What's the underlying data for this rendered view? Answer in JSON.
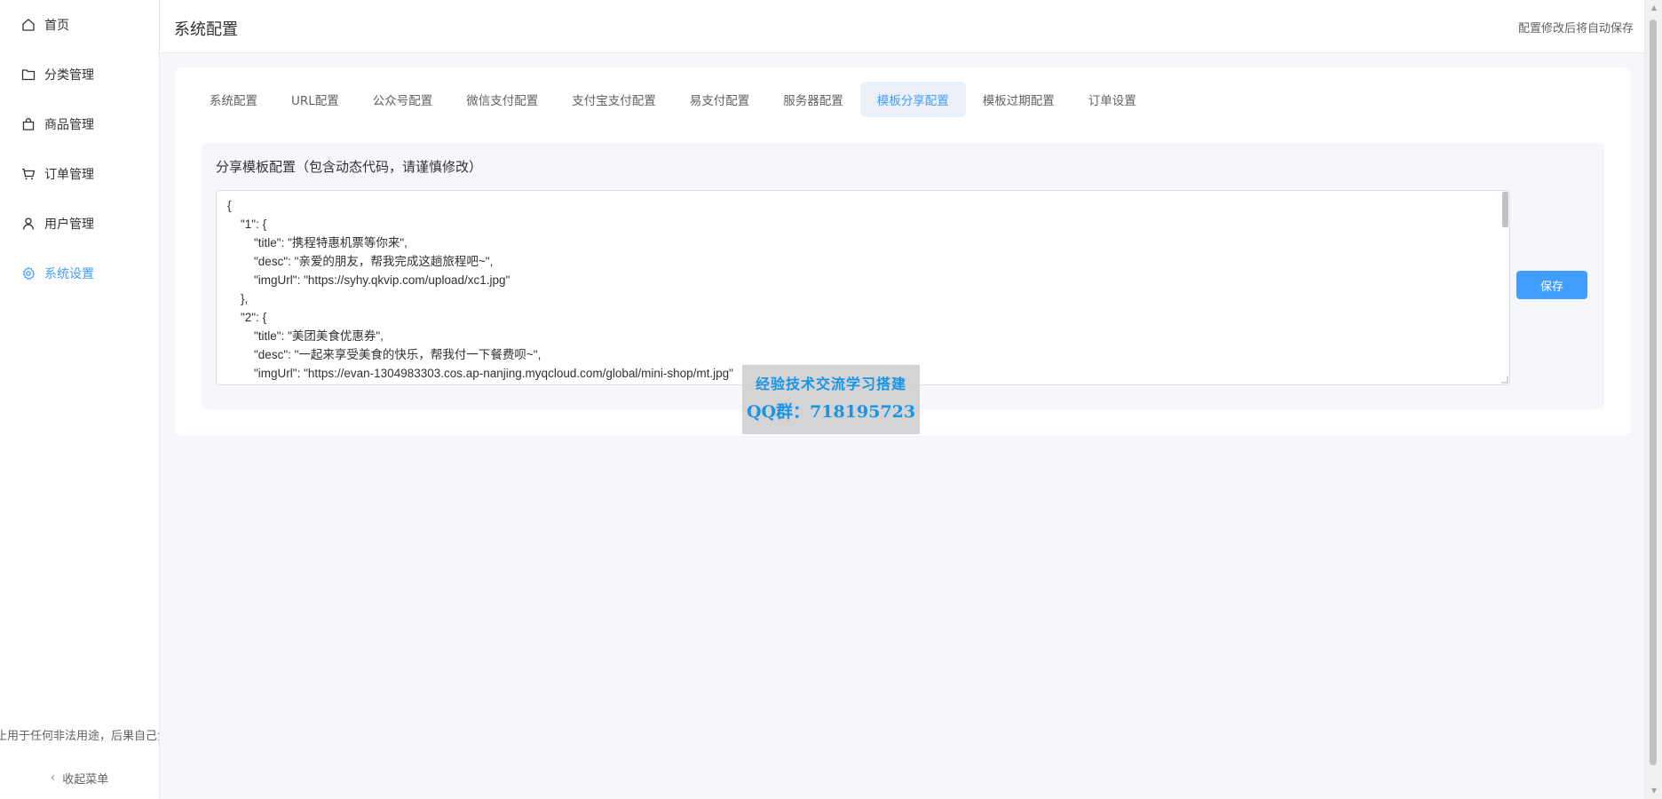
{
  "sidebar": {
    "items": [
      {
        "label": "首页",
        "icon": "home-icon"
      },
      {
        "label": "分类管理",
        "icon": "folder-icon"
      },
      {
        "label": "商品管理",
        "icon": "bag-icon"
      },
      {
        "label": "订单管理",
        "icon": "cart-icon"
      },
      {
        "label": "用户管理",
        "icon": "user-icon"
      },
      {
        "label": "系统设置",
        "icon": "gear-icon",
        "active": true
      }
    ],
    "disclaimer": "禁止用于任何非法用途，后果自己负责",
    "collapse_label": "收起菜单"
  },
  "header": {
    "title": "系统配置",
    "note": "配置修改后将自动保存"
  },
  "tabs": [
    {
      "label": "系统配置"
    },
    {
      "label": "URL配置"
    },
    {
      "label": "公众号配置"
    },
    {
      "label": "微信支付配置"
    },
    {
      "label": "支付宝支付配置"
    },
    {
      "label": "易支付配置"
    },
    {
      "label": "服务器配置"
    },
    {
      "label": "模板分享配置",
      "active": true
    },
    {
      "label": "模板过期配置"
    },
    {
      "label": "订单设置"
    }
  ],
  "panel": {
    "label": "分享模板配置（包含动态代码，请谨慎修改）",
    "editor_value": "{\n    \"1\": {\n        \"title\": \"携程特惠机票等你来\",\n        \"desc\": \"亲爱的朋友，帮我完成这趟旅程吧~\",\n        \"imgUrl\": \"https://syhy.qkvip.com/upload/xc1.jpg\"\n    },\n    \"2\": {\n        \"title\": \"美团美食优惠券\",\n        \"desc\": \"一起来享受美食的快乐，帮我付一下餐费呗~\",\n        \"imgUrl\": \"https://evan-1304983303.cos.ap-nanjing.myqcloud.com/global/mini-shop/mt.jpg\"",
    "save_label": "保存"
  },
  "watermark": {
    "line1": "经验技术交流学习搭建",
    "line2": "QQ群：718195723"
  },
  "colors": {
    "accent": "#409eff",
    "watermark_text": "#1a94e6"
  }
}
